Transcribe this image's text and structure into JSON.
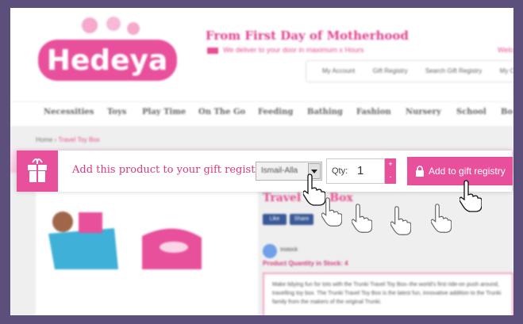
{
  "header": {
    "logo_text": "Hedeya",
    "tagline": "From First Day of Motherhood",
    "delivery": "We deliver to your door in maximum x Hours",
    "login": "Welco",
    "top_links": [
      "My Account",
      "Gift Registry",
      "Search Gift Registry",
      "My C"
    ]
  },
  "nav": {
    "items": [
      "Necessities",
      "Toys",
      "Play Time",
      "On The Go",
      "Feeding",
      "Bathing",
      "Fashion",
      "Nursery",
      "School",
      "Bo"
    ]
  },
  "breadcrumb": {
    "home": "Home",
    "sep": "›",
    "current": "Travel Toy Box"
  },
  "product": {
    "title": "Travel Toy Box",
    "share_labels": [
      "Like",
      "Share"
    ],
    "stock_label": "Instock",
    "quantity_in_stock": "Product Quantity in Stock: 4",
    "description": "Make tidying fun for tots with the Trunki Travel Toy Box–the world's first ride-on push around, travelling toy box. The Trunki Travel Toy Box is the latest fun, innovative addition to the Trunki family from the makers of the original Trunki."
  },
  "registry_bar": {
    "label": "Add this product to your gift registry",
    "registry_select_value": "Ismail-Alla",
    "qty_label": "Qty:",
    "qty_value": "1",
    "inc": "+",
    "dec": "-",
    "add_button": "Add to gift registry"
  },
  "colors": {
    "brand_pink": "#e8509b",
    "frame_bg": "#5c4f7c"
  }
}
